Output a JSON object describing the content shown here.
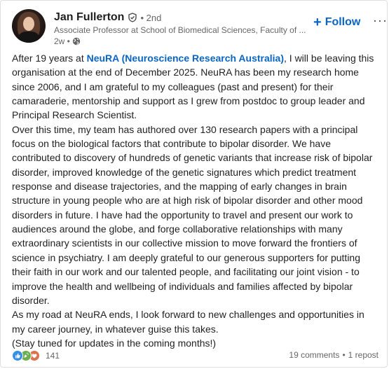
{
  "author": {
    "name": "Jan Fullerton",
    "degree": "• 2nd",
    "headline": "Associate Professor at School of Biomedical Sciences, Faculty of ...",
    "time": "2w •"
  },
  "actions": {
    "follow_label": "Follow",
    "more_label": "···"
  },
  "post": {
    "intro_prefix": "After 19 years at ",
    "link_text": "NeuRA (Neuroscience Research Australia)",
    "intro_suffix": ", I will be leaving this organisation at the end of December 2025. NeuRA has been my research home since 2006, and I am grateful to my colleagues (past and present) for their camaraderie, mentorship and support as I grew from postdoc to group leader and Principal Research Scientist.",
    "paragraph2": "Over this time, my team has authored over 130 research papers with a principal focus on the biological factors that contribute to bipolar disorder. We have contributed to discovery of hundreds of genetic variants that increase risk of bipolar disorder, improved knowledge of the genetic signatures which predict treatment response and disease trajectories, and the mapping of early changes in brain structure in young people who are at high risk of bipolar disorder and other mood disorders in future. I have had the opportunity to travel and present our work to audiences around the globe, and forge collaborative relationships with many extraordinary scientists in our collective mission to move forward the frontiers of science in psychiatry. I am deeply grateful to our generous supporters for putting their faith in our work and our talented people, and facilitating our joint vision - to improve the health and wellbeing of individuals and families affected by bipolar disorder.",
    "paragraph3": "As my road at NeuRA ends, I look forward to new challenges and opportunities in my career journey, in whatever guise this takes.",
    "paragraph4": "(Stay tuned for updates in the coming months!)"
  },
  "social": {
    "reaction_count": "141",
    "comments": "19 comments",
    "separator": "•",
    "reposts": "1 repost"
  },
  "icons": {
    "verified": "verified-shield-icon",
    "visibility": "globe-icon",
    "reactions": [
      "like-icon",
      "celebrate-icon",
      "love-icon"
    ]
  },
  "colors": {
    "accent": "#0a66c2",
    "text": "#1f1f1f",
    "secondary_text": "#666666",
    "like": "#378fe9",
    "celebrate": "#44712e",
    "love": "#df704d"
  }
}
